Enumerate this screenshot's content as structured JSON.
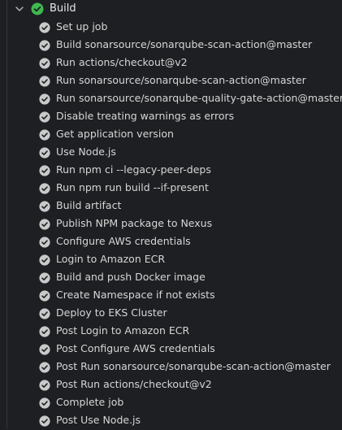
{
  "job": {
    "title": "Build",
    "status": "success",
    "expanded": true,
    "status_icon": "check-circle-filled-icon",
    "toggle_icon": "chevron-down-icon"
  },
  "colors": {
    "background": "#1e1f22",
    "job_check": "#3fb950",
    "step_check": "#c9c9c9",
    "text": "#d6d6d6"
  },
  "steps": [
    {
      "label": "Set up job"
    },
    {
      "label": "Build sonarsource/sonarqube-scan-action@master"
    },
    {
      "label": "Run actions/checkout@v2"
    },
    {
      "label": "Run sonarsource/sonarqube-scan-action@master"
    },
    {
      "label": "Run sonarsource/sonarqube-quality-gate-action@master"
    },
    {
      "label": "Disable treating warnings as errors"
    },
    {
      "label": "Get application version"
    },
    {
      "label": "Use Node.js"
    },
    {
      "label": "Run npm ci --legacy-peer-deps"
    },
    {
      "label": "Run npm run build --if-present"
    },
    {
      "label": "Build artifact"
    },
    {
      "label": "Publish NPM package to Nexus"
    },
    {
      "label": "Configure AWS credentials"
    },
    {
      "label": "Login to Amazon ECR"
    },
    {
      "label": "Build and push Docker image"
    },
    {
      "label": "Create Namespace if not exists"
    },
    {
      "label": "Deploy to EKS Cluster"
    },
    {
      "label": "Post Login to Amazon ECR"
    },
    {
      "label": "Post Configure AWS credentials"
    },
    {
      "label": "Post Run sonarsource/sonarqube-scan-action@master"
    },
    {
      "label": "Post Run actions/checkout@v2"
    },
    {
      "label": "Complete job"
    },
    {
      "label": "Post Use Node.js"
    }
  ]
}
